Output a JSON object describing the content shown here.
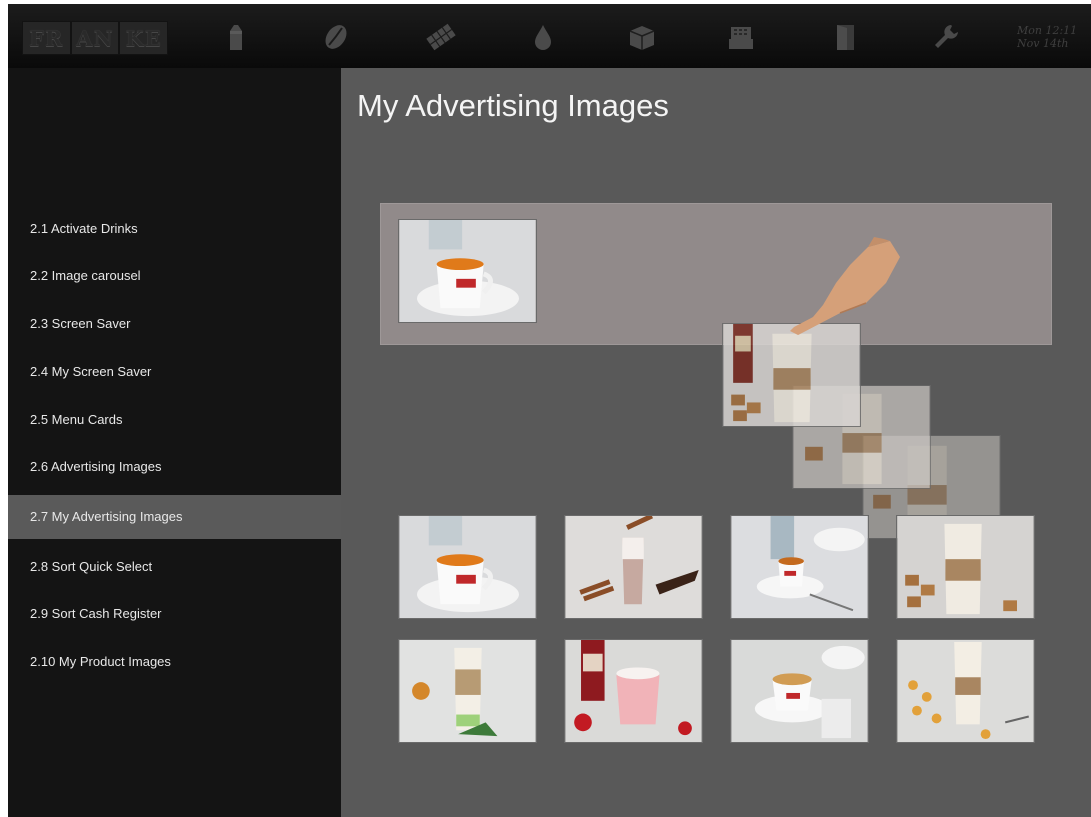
{
  "brand": {
    "logo_letters": [
      "FR",
      "AN",
      "KE"
    ]
  },
  "topbar": {
    "icons": [
      "milk-carton-icon",
      "coffee-bean-icon",
      "chocolate-bar-icon",
      "water-drop-icon",
      "box-icon",
      "cash-drawer-icon",
      "door-icon",
      "wrench-icon"
    ],
    "datetime": {
      "line1": "Mon 12:11",
      "line2": "Nov 14th"
    }
  },
  "sidebar": {
    "items": [
      {
        "label": "2.1 Activate Drinks"
      },
      {
        "label": "2.2 Image carousel"
      },
      {
        "label": "2.3 Screen Saver"
      },
      {
        "label": "2.4 My Screen Saver"
      },
      {
        "label": "2.5 Menu Cards"
      },
      {
        "label": "2.6 Advertising Images"
      },
      {
        "label": "2.7 My Advertising Images",
        "active": true
      },
      {
        "label": "2.8 Sort Quick Select"
      },
      {
        "label": "2.9 Sort Cash Register"
      },
      {
        "label": "2.10 My Product Images"
      }
    ]
  },
  "main": {
    "title": "My Advertising Images",
    "selected_images": [
      "espresso-cup"
    ],
    "dragged_image": "latte-macchiato-glass",
    "gallery": [
      "espresso-cup",
      "hot-chocolate-glass",
      "coffee-cup-saucer",
      "latte-macchiato-glass",
      "layered-latte-glass",
      "strawberry-milk-glass",
      "cappuccino-cup",
      "layered-latte-caramel"
    ]
  },
  "colors": {
    "sidebar_bg": "#141414",
    "main_bg": "#595959",
    "active_item_bg": "#5a5a5a",
    "drop_zone_bg": "#918a8a"
  }
}
